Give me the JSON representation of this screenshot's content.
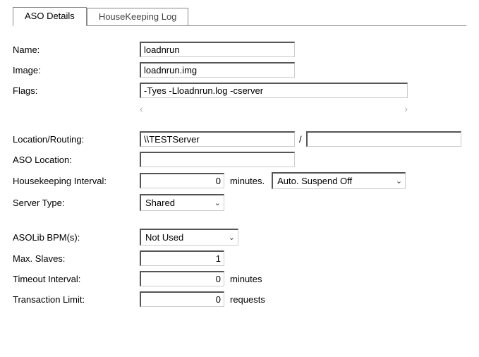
{
  "tabs": {
    "t0": "ASO Details",
    "t1": "HouseKeeping Log"
  },
  "labels": {
    "name": "Name:",
    "image": "Image:",
    "flags": "Flags:",
    "location_routing": "Location/Routing:",
    "aso_location": "ASO Location:",
    "housekeeping_interval": "Housekeeping Interval:",
    "server_type": "Server Type:",
    "asolib_bpm": "ASOLib BPM(s):",
    "max_slaves": "Max. Slaves:",
    "timeout_interval": "Timeout Interval:",
    "transaction_limit": "Transaction Limit:"
  },
  "values": {
    "name": "loadnrun",
    "image": "loadnrun.img",
    "flags": "-Tyes -Lloadnrun.log -cserver",
    "location": "\\\\TESTServer",
    "routing": "",
    "aso_location": "",
    "housekeeping_interval": "0",
    "auto_suspend": "Auto. Suspend Off",
    "server_type": "Shared",
    "asolib_bpm": "Not Used",
    "max_slaves": "1",
    "timeout_interval": "0",
    "transaction_limit": "0"
  },
  "units": {
    "minutes_period": "minutes.",
    "minutes": "minutes",
    "requests": "requests",
    "slash": "/"
  },
  "separators": {
    "left_arrow": "‹",
    "right_arrow": "›"
  }
}
